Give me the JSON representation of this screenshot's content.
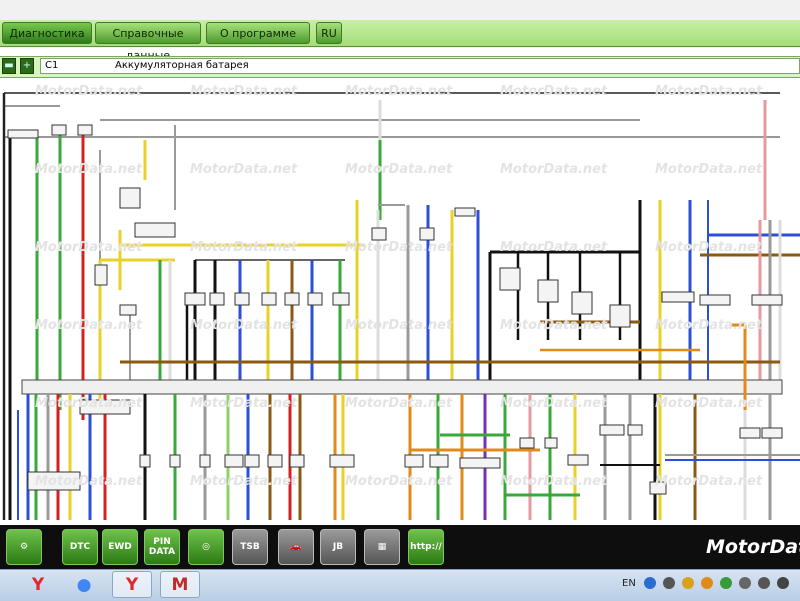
{
  "menu": {
    "items": [
      {
        "label": "Диагностика",
        "active": true
      },
      {
        "label": "Справочные данные",
        "active": false
      },
      {
        "label": "О программе",
        "active": false
      },
      {
        "label": "RU",
        "active": false
      }
    ]
  },
  "component": {
    "code": "C1",
    "name": "Аккумуляторная батарея",
    "expand_icon": "plus-icon",
    "collapse_icon": "minus-icon"
  },
  "diagram": {
    "watermark": "MotorData.net",
    "wire_colors": {
      "black": "#111111",
      "green": "#39a83a",
      "red": "#d42020",
      "yellow": "#e8d228",
      "blue": "#2c4fd6",
      "brown": "#8a5a12",
      "gray": "#9a9a9a",
      "white": "#dcdcdc",
      "violet": "#7a2fb8",
      "pink": "#e59aa0",
      "orange": "#e08a1c",
      "lightgreen": "#8fd06a"
    }
  },
  "toolbar": {
    "buttons": [
      {
        "icon": "component-locator-icon",
        "label": ""
      },
      {
        "icon": "dtc-icon",
        "label": "DTC"
      },
      {
        "icon": "ewd-icon",
        "label": "EWD"
      },
      {
        "icon": "pin-data-icon",
        "label": "PIN DATA"
      },
      {
        "icon": "tester-icon",
        "label": ""
      },
      {
        "icon": "tsb-icon",
        "label": "TSB"
      },
      {
        "icon": "car-service-icon",
        "label": ""
      },
      {
        "icon": "jb-icon",
        "label": "JB"
      },
      {
        "icon": "fuse-block-icon",
        "label": ""
      },
      {
        "icon": "web-icon",
        "label": "http://"
      }
    ],
    "brand": "MotorData"
  },
  "taskbar": {
    "apps": [
      {
        "icon": "yandex-browser-icon",
        "color": "#e3262c"
      },
      {
        "icon": "chrome-icon",
        "color": "#4285f4"
      },
      {
        "icon": "yandex-browser-icon",
        "color": "#e3262c"
      },
      {
        "icon": "motordata-app-icon",
        "color": "#c02a2a"
      }
    ],
    "language": "EN",
    "tray_icons": [
      "help-icon",
      "arrow-up-icon",
      "speaker-icon",
      "network-icon",
      "shield-icon",
      "power-icon",
      "display-icon",
      "volume-icon"
    ]
  }
}
